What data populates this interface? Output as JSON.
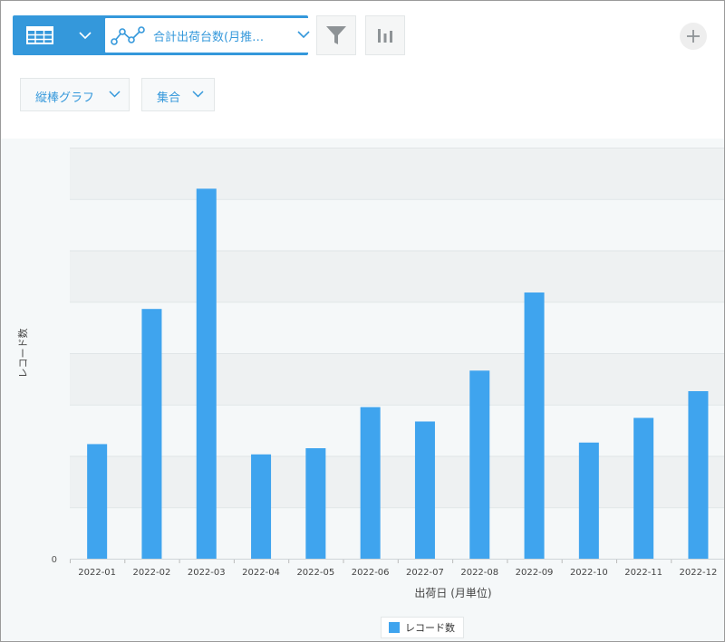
{
  "toolbar": {
    "graph_select_label": "合計出荷台数(月推…",
    "chart_type_label": "縦棒グラフ",
    "aggregate_label": "集合"
  },
  "colors": {
    "accent": "#3498db",
    "bar": "#3fa4ee"
  },
  "chart_data": {
    "type": "bar",
    "xlabel": "出荷日 (月単位)",
    "ylabel": "レコード数",
    "y_tick_labels_visible": [
      "0"
    ],
    "ylim": [
      0,
      8
    ],
    "y_tick_step": 1,
    "grid": true,
    "legend_position": "bottom",
    "categories": [
      "2022-01",
      "2022-02",
      "2022-03",
      "2022-04",
      "2022-05",
      "2022-06",
      "2022-07",
      "2022-08",
      "2022-09",
      "2022-10",
      "2022-11",
      "2022-12"
    ],
    "series": [
      {
        "name": "レコード数",
        "values": [
          2.23,
          4.86,
          7.2,
          2.03,
          2.15,
          2.95,
          2.67,
          3.66,
          5.18,
          2.26,
          2.74,
          3.26
        ]
      }
    ]
  }
}
